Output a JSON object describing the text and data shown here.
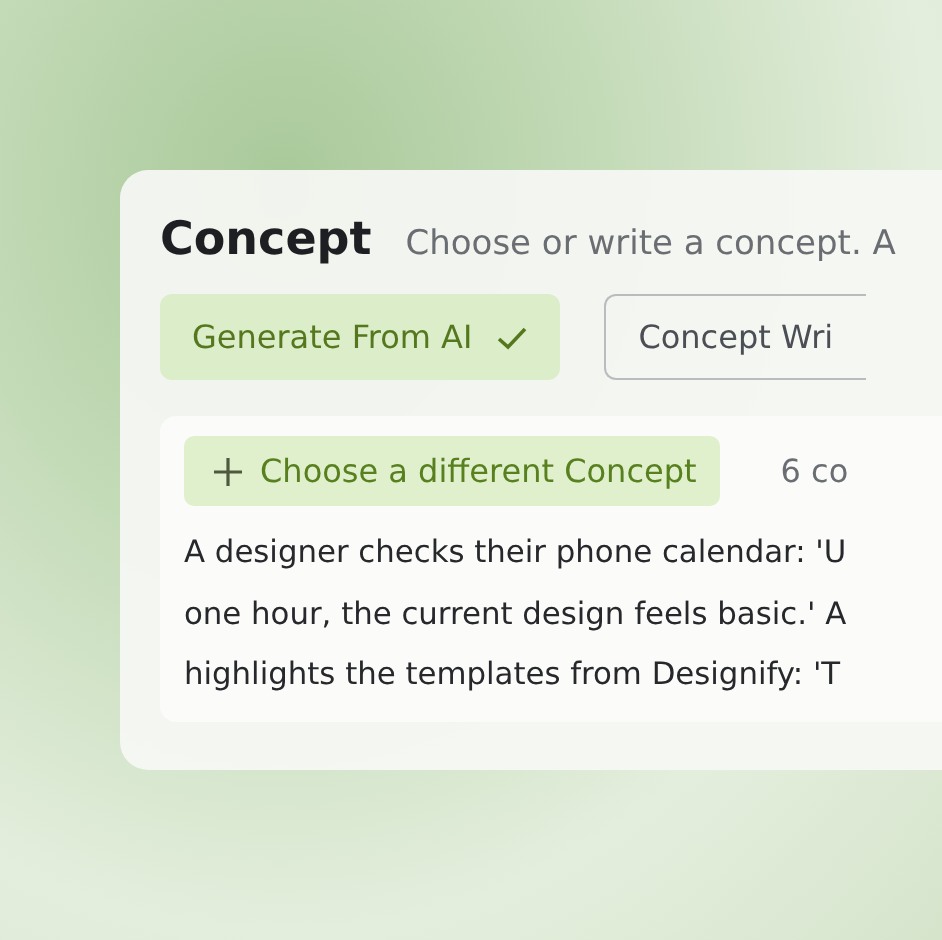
{
  "header": {
    "title": "Concept",
    "subtitle": "Choose or write a concept. A"
  },
  "tabs": [
    {
      "label": "Generate From AI",
      "selected": true
    },
    {
      "label": "Concept Wri",
      "selected": false
    }
  ],
  "concept_panel": {
    "action": "Choose a different Concept",
    "count": "6 co",
    "lines": [
      "A designer checks their phone calendar: 'U",
      "one hour, the current design feels basic.' A",
      "highlights the templates from Designify: 'T"
    ]
  }
}
